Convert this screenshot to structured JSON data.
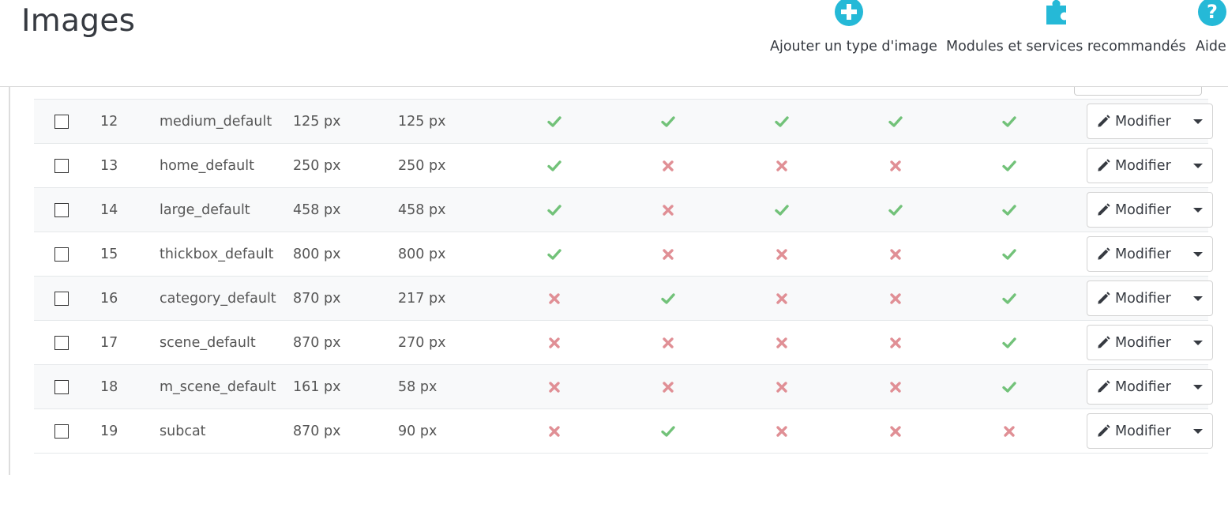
{
  "page": {
    "title": "Images"
  },
  "toolbar": {
    "add_image_type": {
      "label": "Ajouter un type d'image",
      "icon": "add-circle-icon"
    },
    "modules": {
      "label": "Modules et services recommandés",
      "icon": "puzzle-icon"
    },
    "help": {
      "label": "Aide",
      "icon": "help-circle-icon"
    }
  },
  "colors": {
    "accent": "#25b9d7",
    "check": "#72c279",
    "cross": "#e08f95"
  },
  "table": {
    "action_label": "Modifier",
    "rows": [
      {
        "id": "12",
        "name": "medium_default",
        "width": "125 px",
        "height": "125 px",
        "flags": [
          true,
          true,
          true,
          true,
          true
        ]
      },
      {
        "id": "13",
        "name": "home_default",
        "width": "250 px",
        "height": "250 px",
        "flags": [
          true,
          false,
          false,
          false,
          true
        ]
      },
      {
        "id": "14",
        "name": "large_default",
        "width": "458 px",
        "height": "458 px",
        "flags": [
          true,
          false,
          true,
          true,
          true
        ]
      },
      {
        "id": "15",
        "name": "thickbox_default",
        "width": "800 px",
        "height": "800 px",
        "flags": [
          true,
          false,
          false,
          false,
          true
        ]
      },
      {
        "id": "16",
        "name": "category_default",
        "width": "870 px",
        "height": "217 px",
        "flags": [
          false,
          true,
          false,
          false,
          true
        ]
      },
      {
        "id": "17",
        "name": "scene_default",
        "width": "870 px",
        "height": "270 px",
        "flags": [
          false,
          false,
          false,
          false,
          true
        ]
      },
      {
        "id": "18",
        "name": "m_scene_default",
        "width": "161 px",
        "height": "58 px",
        "flags": [
          false,
          false,
          false,
          false,
          true
        ]
      },
      {
        "id": "19",
        "name": "subcat",
        "width": "870 px",
        "height": "90 px",
        "flags": [
          false,
          true,
          false,
          false,
          false
        ]
      }
    ]
  }
}
